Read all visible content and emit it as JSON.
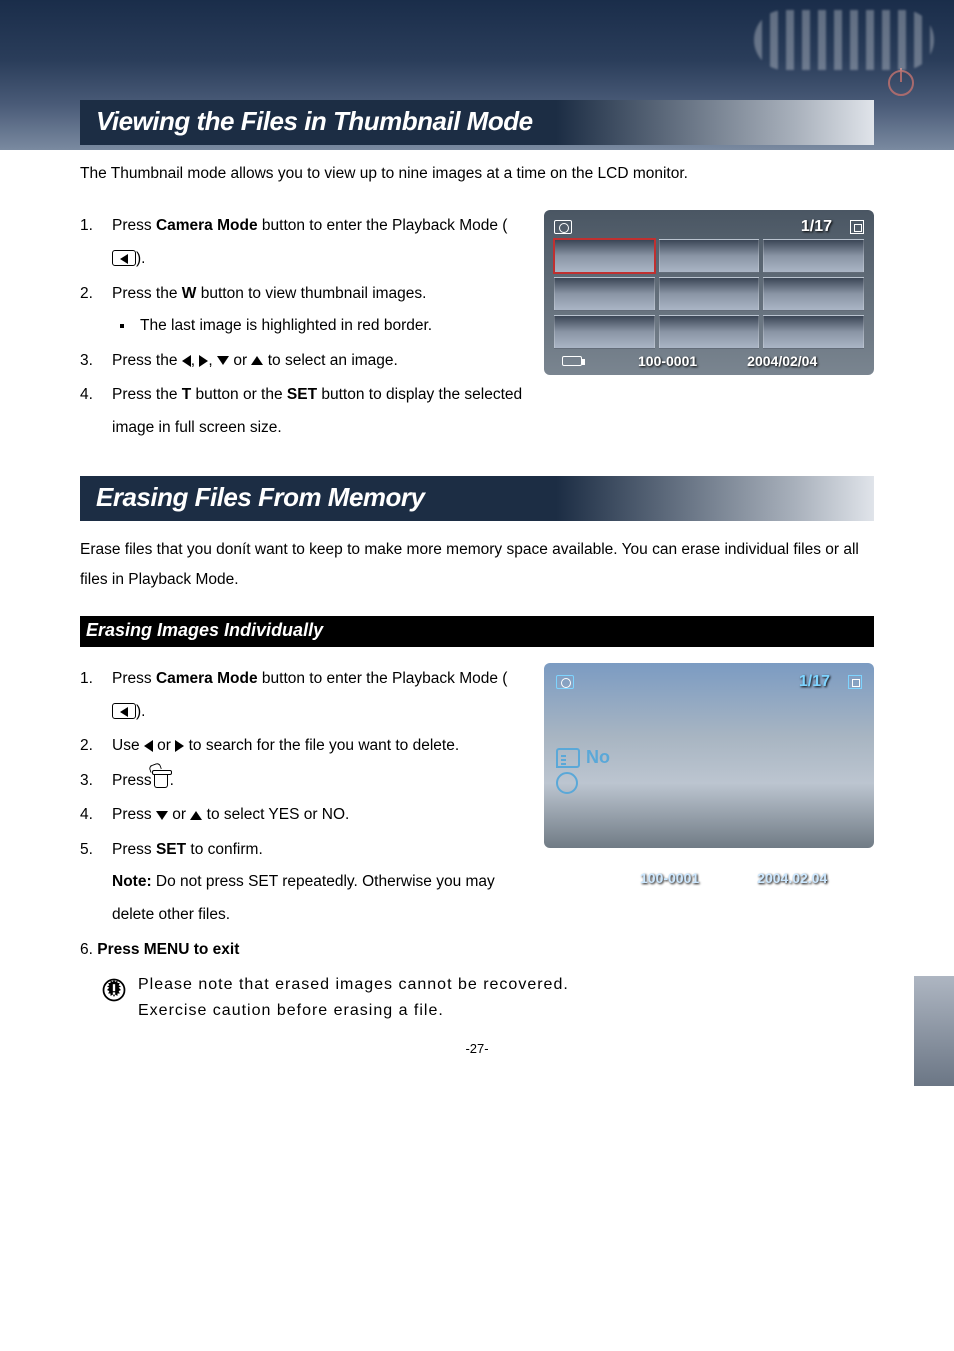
{
  "section1": {
    "title": "Viewing the Files in Thumbnail Mode",
    "intro": "The Thumbnail mode allows you to view up to nine images at a time on the LCD monitor.",
    "steps": {
      "s1a": "Press ",
      "s1b": "Camera Mode",
      "s1c": " button to enter the Playback Mode (",
      "s1d": ").",
      "s2a": "Press the ",
      "s2b": "W",
      "s2c": " button to view thumbnail images.",
      "s2_sub": "The last image is highlighted in red border.",
      "s3a": "Press the ",
      "s3b": ", ",
      "s3c": ", ",
      "s3d": " or ",
      "s3e": " to select an image.",
      "s4a": "Press the ",
      "s4b": "T",
      "s4c": " button or the ",
      "s4d": "SET",
      "s4e": " button to display the selected image in full screen size."
    },
    "lcd": {
      "counter": "1/17",
      "file": "100-0001",
      "date": "2004/02/04"
    }
  },
  "section2": {
    "title": "Erasing Files From Memory",
    "intro": "Erase files that you donít want to keep to make more memory space available. You can erase individual files or all files in Playback Mode.",
    "subheading": "Erasing Images Individually",
    "steps": {
      "s1a": "Press ",
      "s1b": "Camera Mode",
      "s1c": " button to enter the Playback Mode (",
      "s1d": ").",
      "s2a": "Use ",
      "s2b": " or ",
      "s2c": " to search for the file you want to delete.",
      "s3a": "Press",
      "s3b": ".",
      "s4a": "Press ",
      "s4b": " or ",
      "s4c": " to select YES or NO.",
      "s5a": "Press ",
      "s5b": "SET",
      "s5c": " to confirm.",
      "note_label": "Note:",
      "note_text": " Do not press SET repeatedly. Otherwise you may delete other files.",
      "s6": "Press MENU to exit"
    },
    "lcd": {
      "counter": "1/17",
      "no_label": "No",
      "file": "100-0001",
      "date": "2004.02.04"
    },
    "warning_line1": "Please note that erased images cannot be recovered.",
    "warning_line2": "Exercise caution before erasing a file."
  },
  "page_number": "-27-"
}
